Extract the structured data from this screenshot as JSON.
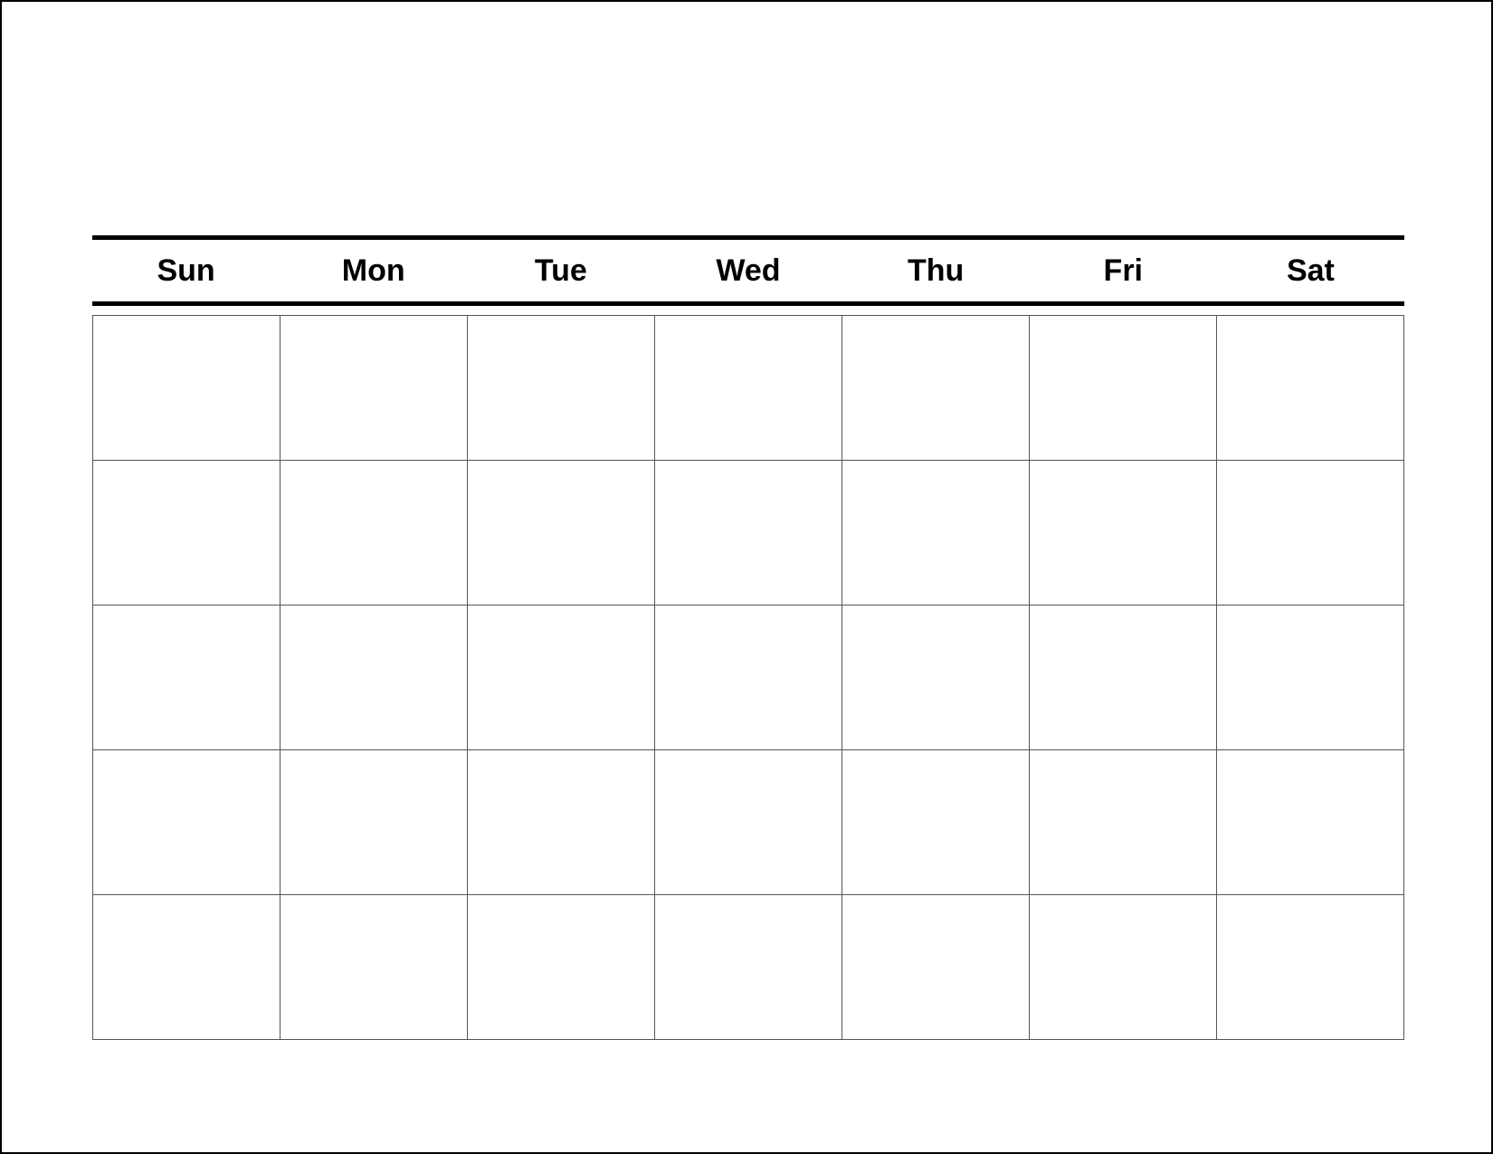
{
  "calendar": {
    "days": [
      "Sun",
      "Mon",
      "Tue",
      "Wed",
      "Thu",
      "Fri",
      "Sat"
    ],
    "weeks": 5
  }
}
